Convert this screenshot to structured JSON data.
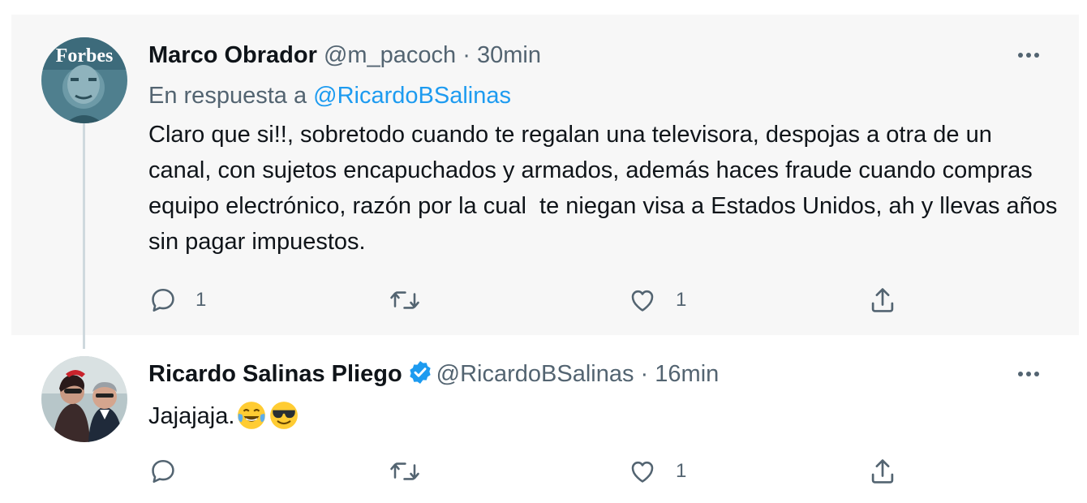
{
  "tweets": [
    {
      "name": "Marco Obrador",
      "handle": "@m_pacoch",
      "separator": "·",
      "time": "30min",
      "reply_prefix": "En respuesta a",
      "reply_handle": "@RicardoBSalinas",
      "avatar_text": "Forbes",
      "text": "Claro que si!!, sobretodo cuando te regalan una televisora, despojas a otra de un canal, con sujetos encapuchados y armados, además haces fraude cuando compras equipo electrónico, razón por la cual  te niegan visa a Estados Unidos, ah y llevas años sin pagar impuestos.",
      "reply_count": "1",
      "retweet_count": "",
      "like_count": "1"
    },
    {
      "name": "Ricardo Salinas Pliego",
      "verified": true,
      "handle": "@RicardoBSalinas",
      "separator": "·",
      "time": "16min",
      "text": "Jajajaja.",
      "emojis": [
        "face-with-tears-of-joy",
        "smiling-face-with-sunglasses"
      ],
      "reply_count": "",
      "retweet_count": "",
      "like_count": "1"
    }
  ],
  "colors": {
    "accent": "#1d9bf0",
    "secondary_text": "#536471",
    "primary_text": "#0f1419",
    "highlight_bg": "#f7f7f7"
  }
}
